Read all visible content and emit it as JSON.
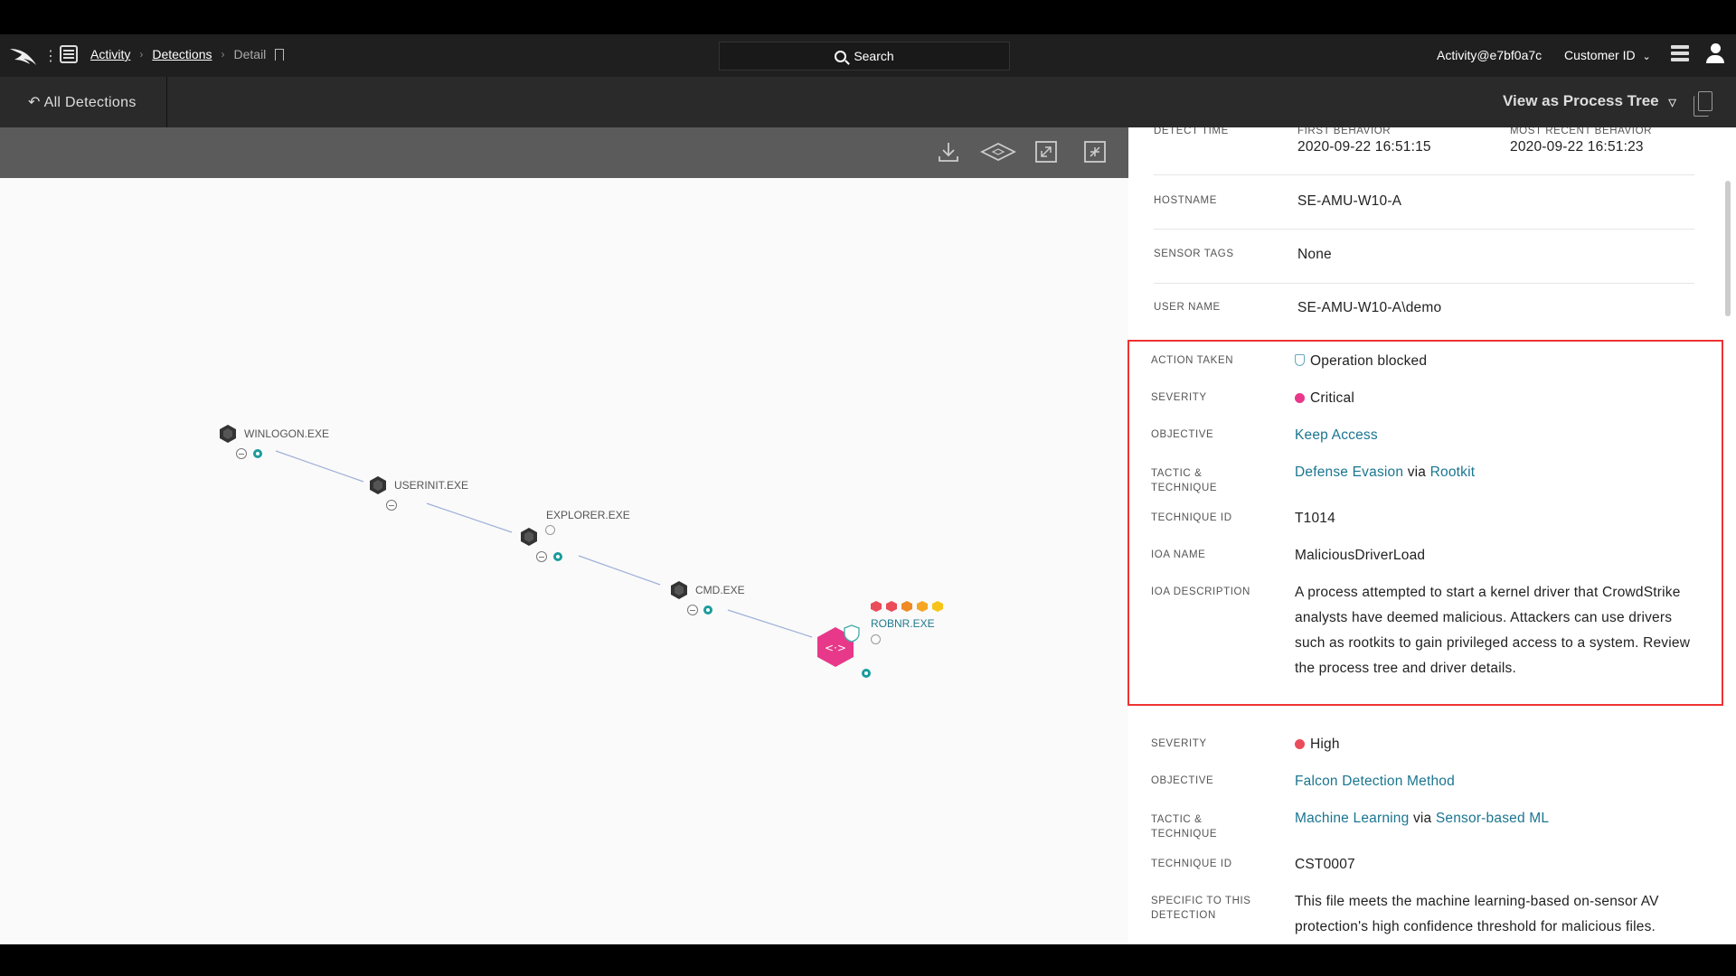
{
  "nav": {
    "breadcrumb": [
      "Activity",
      "Detections",
      "Detail"
    ],
    "search_label": "Search",
    "user": "Activity@e7bf0a7c",
    "customer": "Customer ID"
  },
  "subnav": {
    "back_label": "All Detections",
    "view_as": "View as Process Tree"
  },
  "graph": {
    "nodes": [
      "WINLOGON.EXE",
      "USERINIT.EXE",
      "EXPLORER.EXE",
      "CMD.EXE",
      "ROBNR.EXE"
    ],
    "alert_node_glyph": "<·>"
  },
  "detail": {
    "top_label": "DETECT TIME",
    "first_behavior_label": "FIRST BEHAVIOR",
    "first_behavior": "2020-09-22 16:51:15",
    "recent_behavior_label": "MOST RECENT BEHAVIOR",
    "recent_behavior": "2020-09-22 16:51:23",
    "hostname_label": "HOSTNAME",
    "hostname": "SE-AMU-W10-A",
    "sensor_tags_label": "SENSOR TAGS",
    "sensor_tags": "None",
    "username_label": "USER NAME",
    "username": "SE-AMU-W10-A\\demo"
  },
  "behavior1": {
    "action_label": "ACTION TAKEN",
    "action": "Operation blocked",
    "severity_label": "SEVERITY",
    "severity": "Critical",
    "severity_color": "#e8388a",
    "objective_label": "OBJECTIVE",
    "objective": "Keep Access",
    "tactic_label_1": "TACTIC &",
    "tactic_label_2": "TECHNIQUE",
    "tactic": "Defense Evasion",
    "via": "via",
    "technique": "Rootkit",
    "technique_id_label": "TECHNIQUE ID",
    "technique_id": "T1014",
    "ioa_name_label": "IOA NAME",
    "ioa_name": "MaliciousDriverLoad",
    "ioa_desc_label": "IOA DESCRIPTION",
    "ioa_desc": "A process attempted to start a kernel driver that CrowdStrike analysts have deemed malicious. Attackers can use drivers such as rootkits to gain privileged access to a system. Review the process tree and driver details."
  },
  "behavior2": {
    "severity_label": "SEVERITY",
    "severity": "High",
    "severity_color": "#ea4c5a",
    "objective_label": "OBJECTIVE",
    "objective": "Falcon Detection Method",
    "tactic_label_1": "TACTIC &",
    "tactic_label_2": "TECHNIQUE",
    "tactic": "Machine Learning",
    "via": "via",
    "technique": "Sensor-based ML",
    "technique_id_label": "TECHNIQUE ID",
    "technique_id": "CST0007",
    "specific_label_1": "SPECIFIC TO THIS",
    "specific_label_2": "DETECTION",
    "specific": "This file meets the machine learning-based on-sensor AV protection's high confidence threshold for malicious files."
  }
}
